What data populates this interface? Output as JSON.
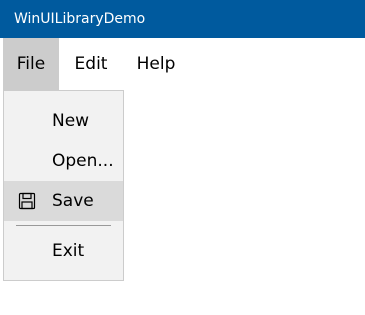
{
  "window": {
    "title": "WinUILibraryDemo"
  },
  "menubar": {
    "items": [
      {
        "label": "File",
        "active": true
      },
      {
        "label": "Edit"
      },
      {
        "label": "Help"
      }
    ]
  },
  "file_menu": {
    "items": [
      {
        "label": "New"
      },
      {
        "label": "Open..."
      },
      {
        "label": "Save",
        "icon": "save-icon",
        "hovered": true
      },
      {
        "label": "Exit"
      }
    ]
  },
  "colors": {
    "titlebar_bg": "#005a9e",
    "active_menu_bg": "#cccccc",
    "dropdown_bg": "#f2f2f2",
    "hover_item_bg": "#dadada"
  }
}
